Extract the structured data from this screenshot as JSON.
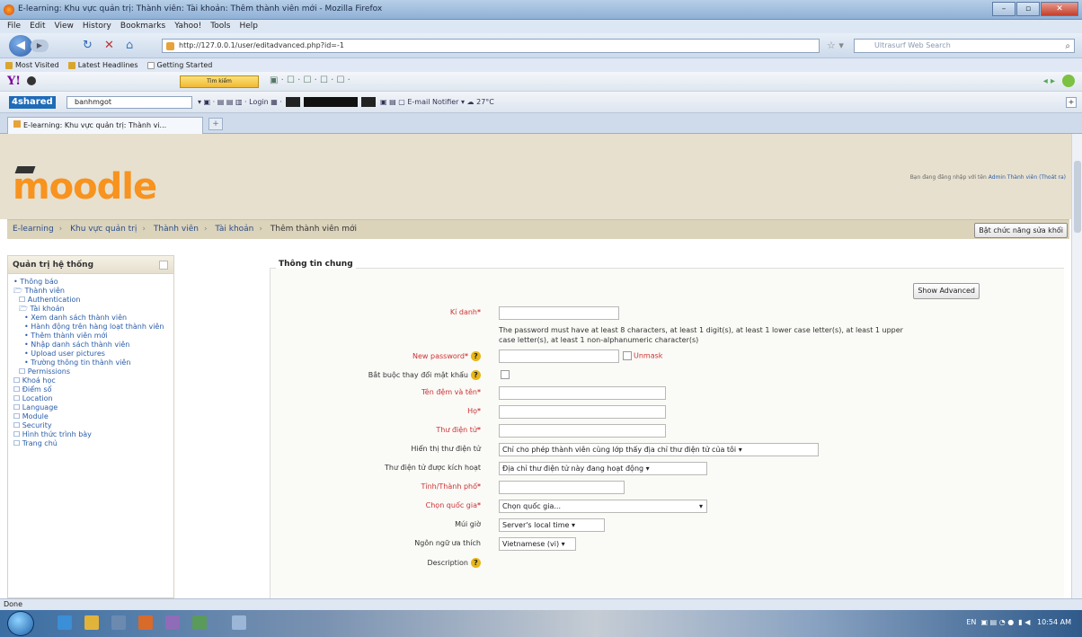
{
  "window": {
    "title": "E-learning: Khu vực quản trị: Thành viên: Tài khoản: Thêm thành viên mới - Mozilla Firefox"
  },
  "menu": [
    "File",
    "Edit",
    "View",
    "History",
    "Bookmarks",
    "Yahoo!",
    "Tools",
    "Help"
  ],
  "nav": {
    "url": "http://127.0.0.1/user/editadvanced.php?id=-1",
    "search_placeholder": "Ultrasurf Web Search"
  },
  "bookmarks": [
    "Most Visited",
    "Latest Headlines",
    "Getting Started"
  ],
  "yahoo": {
    "logo": "Y!",
    "search_button": "Tìm kiếm"
  },
  "toolbar2": {
    "logo": "4shared",
    "input": "banhmgot",
    "login": "Login",
    "email": "E-mail Notifier",
    "temp": "27°C"
  },
  "tab": {
    "title": "E-learning: Khu vực quản trị: Thành vi..."
  },
  "page": {
    "logo": "moodle",
    "login_info": "Bạn đang đăng nhập với tên",
    "login_user": "Admin Thành viên",
    "logout": "(Thoát ra)",
    "breadcrumbs": [
      "E-learning",
      "Khu vực quản trị",
      "Thành viên",
      "Tài khoản",
      "Thêm thành viên mới"
    ],
    "edit_button": "Bật chức năng sửa khối"
  },
  "sidebar": {
    "title": "Quản trị hệ thống",
    "items": [
      {
        "label": "• Thông báo",
        "indent": 0,
        "kind": "link"
      },
      {
        "label": "🗁 Thành viên",
        "indent": 0,
        "kind": "link"
      },
      {
        "label": "☐ Authentication",
        "indent": 1,
        "kind": "link"
      },
      {
        "label": "🗁 Tài khoản",
        "indent": 1,
        "kind": "link"
      },
      {
        "label": "• Xem danh sách thành viên",
        "indent": 2,
        "kind": "link"
      },
      {
        "label": "• Hành động trên hàng loạt thành viên",
        "indent": 2,
        "kind": "link"
      },
      {
        "label": "• Thêm thành viên mới",
        "indent": 2,
        "kind": "link"
      },
      {
        "label": "• Nhập danh sách thành viên",
        "indent": 2,
        "kind": "link"
      },
      {
        "label": "• Upload user pictures",
        "indent": 2,
        "kind": "link"
      },
      {
        "label": "• Trường thông tin thành viên",
        "indent": 2,
        "kind": "link"
      },
      {
        "label": "☐ Permissions",
        "indent": 1,
        "kind": "link"
      },
      {
        "label": "☐ Khoá học",
        "indent": 0,
        "kind": "link"
      },
      {
        "label": "☐ Điểm số",
        "indent": 0,
        "kind": "link"
      },
      {
        "label": "☐ Location",
        "indent": 0,
        "kind": "link"
      },
      {
        "label": "☐ Language",
        "indent": 0,
        "kind": "link"
      },
      {
        "label": "☐ Module",
        "indent": 0,
        "kind": "link"
      },
      {
        "label": "☐ Security",
        "indent": 0,
        "kind": "link"
      },
      {
        "label": "☐ Hình thức trình bày",
        "indent": 0,
        "kind": "link"
      },
      {
        "label": "☐ Trang chủ",
        "indent": 0,
        "kind": "link"
      }
    ]
  },
  "form": {
    "legend": "Thông tin chung",
    "show_advanced": "Show Advanced",
    "username_label": "Kí danh",
    "password_note": "The password must have at least 8 characters, at least 1 digit(s), at least 1 lower case letter(s), at least 1 upper case letter(s), at least 1 non-alphanumeric character(s)",
    "new_password_label": "New password",
    "unmask": "Unmask",
    "force_change_label": "Bắt buộc thay đổi mật khẩu",
    "firstname_label": "Tên đệm và tên",
    "lastname_label": "Họ",
    "email_label": "Thư điện tử",
    "email_display_label": "Hiển thị thư điện tử",
    "email_display_value": "Chỉ cho phép thành viên cùng lớp thấy địa chỉ thư điện tử của tôi",
    "email_active_label": "Thư điện tử được kích hoạt",
    "email_active_value": "Địa chỉ thư điện tử này đang hoạt động",
    "city_label": "Tỉnh/Thành phố",
    "country_label": "Chọn quốc gia",
    "country_value": "Chọn quốc gia...",
    "timezone_label": "Múi giờ",
    "timezone_value": "Server's local time",
    "lang_label": "Ngôn ngữ ưa thích",
    "lang_value": "Vietnamese (vi)",
    "description_label": "Description"
  },
  "status": "Done",
  "taskbar": {
    "lang": "EN",
    "time": "10:54 AM"
  }
}
